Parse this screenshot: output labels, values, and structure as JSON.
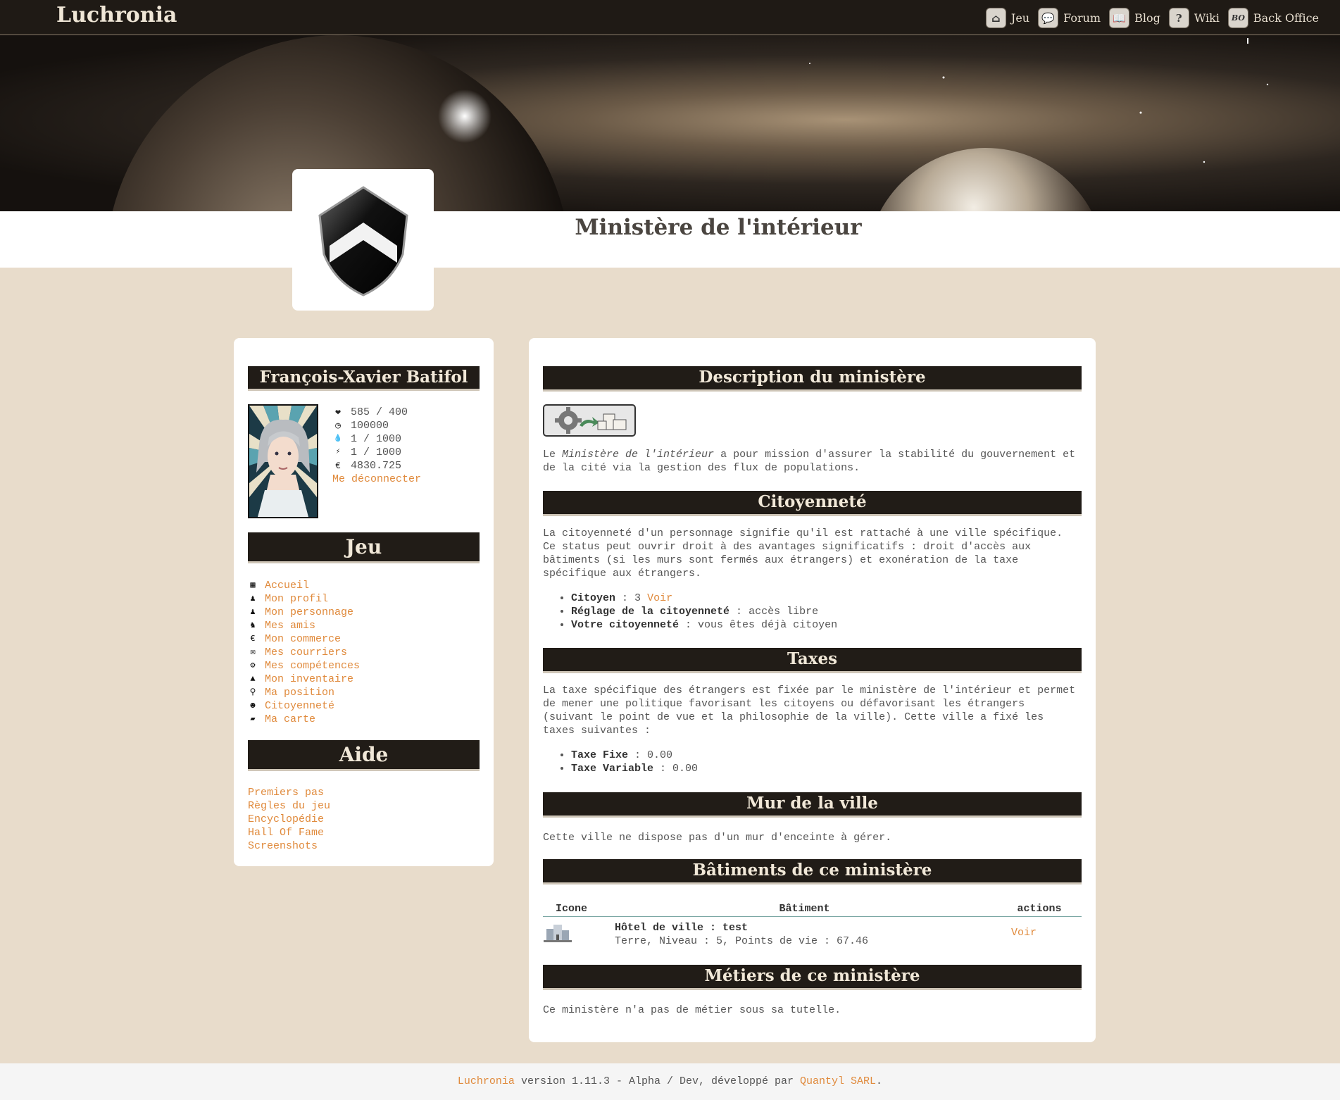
{
  "app": {
    "brand": "Luchronia"
  },
  "nav": [
    {
      "label": "Jeu",
      "icon": "home-icon",
      "glyph": "⌂"
    },
    {
      "label": "Forum",
      "icon": "speech-bubble-icon",
      "glyph": "💬"
    },
    {
      "label": "Blog",
      "icon": "open-book-icon",
      "glyph": "📖"
    },
    {
      "label": "Wiki",
      "icon": "question-mark-icon",
      "glyph": "?"
    },
    {
      "label": "Back Office",
      "icon": "bo-icon",
      "glyph": "BO"
    }
  ],
  "page": {
    "title": "Ministère de l'intérieur"
  },
  "player": {
    "name": "François-Xavier Batifol",
    "stats": [
      {
        "icon": "heart-icon",
        "glyph": "❤",
        "value": "585 / 400"
      },
      {
        "icon": "clock-icon",
        "glyph": "◷",
        "value": "100000"
      },
      {
        "icon": "drop-icon",
        "glyph": "💧",
        "value": "1 / 1000"
      },
      {
        "icon": "lightning-icon",
        "glyph": "⚡",
        "value": "1 / 1000"
      },
      {
        "icon": "euro-coin-icon",
        "glyph": "€",
        "value": "4830.725"
      }
    ],
    "logout": "Me déconnecter"
  },
  "sidebar": {
    "game_title": "Jeu",
    "menu": [
      {
        "label": "Accueil",
        "icon": "calendar-icon",
        "glyph": "▦"
      },
      {
        "label": "Mon profil",
        "icon": "person-icon",
        "glyph": "♟"
      },
      {
        "label": "Mon personnage",
        "icon": "person-icon",
        "glyph": "♟"
      },
      {
        "label": "Mes amis",
        "icon": "friends-icon",
        "glyph": "♞"
      },
      {
        "label": "Mon commerce",
        "icon": "euro-icon",
        "glyph": "€"
      },
      {
        "label": "Mes courriers",
        "icon": "envelope-icon",
        "glyph": "✉"
      },
      {
        "label": "Mes compétences",
        "icon": "gears-icon",
        "glyph": "⚙"
      },
      {
        "label": "Mon inventaire",
        "icon": "backpack-icon",
        "glyph": "▲"
      },
      {
        "label": "Ma position",
        "icon": "map-pin-icon",
        "glyph": "⚲"
      },
      {
        "label": "Citoyenneté",
        "icon": "citizen-head-icon",
        "glyph": "☻"
      },
      {
        "label": "Ma carte",
        "icon": "map-icon",
        "glyph": "▰"
      }
    ],
    "help_title": "Aide",
    "help": [
      "Premiers pas",
      "Règles du jeu",
      "Encyclopédie",
      "Hall Of Fame",
      "Screenshots"
    ]
  },
  "main": {
    "description": {
      "title": "Description du ministère",
      "text_before": "Le ",
      "text_em": "Ministère de l'intérieur",
      "text_after": " a pour mission d'assurer la stabilité du gouvernement et de la cité via la gestion des flux de populations."
    },
    "citizenship": {
      "title": "Citoyenneté",
      "text": "La citoyenneté d'un personnage signifie qu'il est rattaché à une ville spécifique. Ce status peut ouvrir droit à des avantages significatifs : droit d'accès aux bâtiments (si les murs sont fermés aux étrangers) et exonération de la taxe spécifique aux étrangers.",
      "items": [
        {
          "label": "Citoyen",
          "value": "3",
          "link": "Voir"
        },
        {
          "label": "Réglage de la citoyenneté",
          "value": "accès libre"
        },
        {
          "label": "Votre citoyenneté",
          "value": "vous êtes déjà citoyen"
        }
      ]
    },
    "taxes": {
      "title": "Taxes",
      "text": "La taxe spécifique des étrangers est fixée par le ministère de l'intérieur et permet de mener une politique favorisant les citoyens ou défavorisant les étrangers (suivant le point de vue et la philosophie de la ville). Cette ville a fixé les taxes suivantes :",
      "items": [
        {
          "label": "Taxe Fixe",
          "value": "0.00"
        },
        {
          "label": "Taxe Variable",
          "value": "0.00"
        }
      ]
    },
    "wall": {
      "title": "Mur de la ville",
      "text": "Cette ville ne dispose pas d'un mur d'enceinte à gérer."
    },
    "buildings": {
      "title": "Bâtiments de ce ministère",
      "columns": [
        "Icone",
        "Bâtiment",
        "actions"
      ],
      "rows": [
        {
          "name": "Hôtel de ville : test",
          "detail": "Terre, Niveau : 5, Points de vie : 67.46",
          "action": "Voir"
        }
      ]
    },
    "jobs": {
      "title": "Métiers de ce ministère",
      "text": "Ce ministère n'a pas de métier sous sa tutelle."
    }
  },
  "footer": {
    "brand": "Luchronia",
    "middle": " version 1.11.3 - Alpha / Dev, développé par ",
    "company": "Quantyl SARL",
    "end": "."
  },
  "colors": {
    "dark": "#211c17",
    "background": "#e8dccb",
    "link": "#e08a3c"
  }
}
